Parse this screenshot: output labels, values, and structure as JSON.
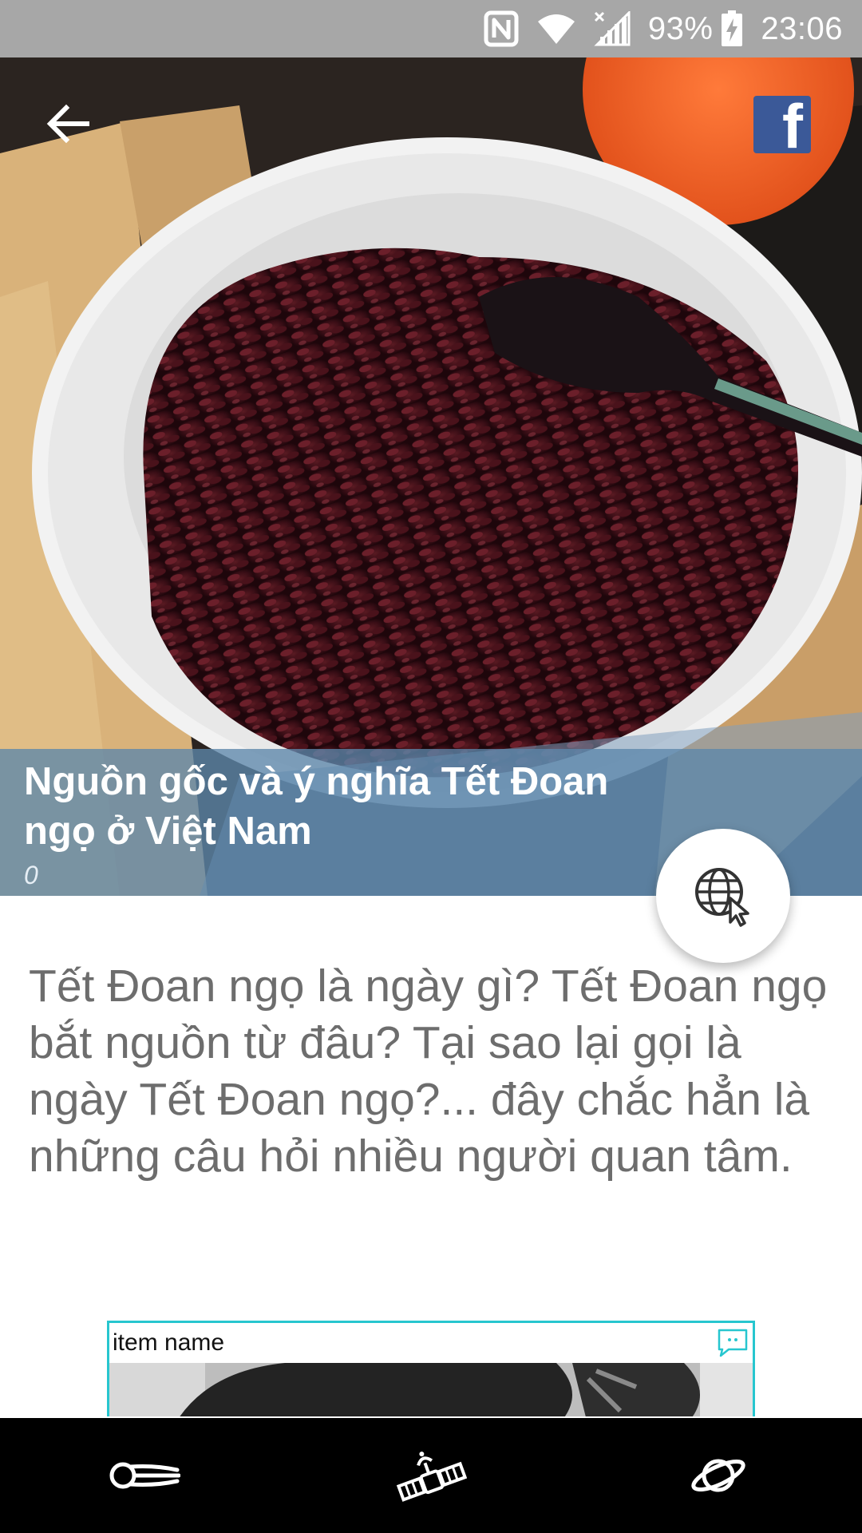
{
  "status_bar": {
    "battery": "93%",
    "time": "23:06",
    "icons": [
      "nfc-icon",
      "wifi-icon",
      "signal-icon",
      "battery-charging-icon"
    ]
  },
  "header": {
    "back_icon": "arrow-left-icon",
    "share_icon": "facebook-icon",
    "share_letter": "f"
  },
  "article": {
    "title": "Nguồn gốc và ý nghĩa Tết Đoan ngọ ở Việt Nam",
    "views": "0",
    "summary": "Tết Đoan ngọ là ngày gì? Tết Đoan ngọ bắt nguồn từ đâu? Tại sao lại gọi là ngày Tết Đoan ngọ?... đây chắc hẳn là những câu hỏi nhiều người quan tâm.",
    "fab_icon": "globe-cursor-icon"
  },
  "card": {
    "item_name": "item name",
    "chat_icon": "chat-bubble-icon",
    "border_color": "#27c6cf"
  },
  "bottom_nav": {
    "items": [
      {
        "icon": "comet-icon"
      },
      {
        "icon": "satellite-icon"
      },
      {
        "icon": "planet-icon"
      }
    ]
  },
  "colors": {
    "status_bar": "#a7a7a7",
    "title_band": "#5c86ab",
    "facebook": "#3b5998",
    "summary_text": "#6d6d6d",
    "bottom_nav": "#000000"
  }
}
